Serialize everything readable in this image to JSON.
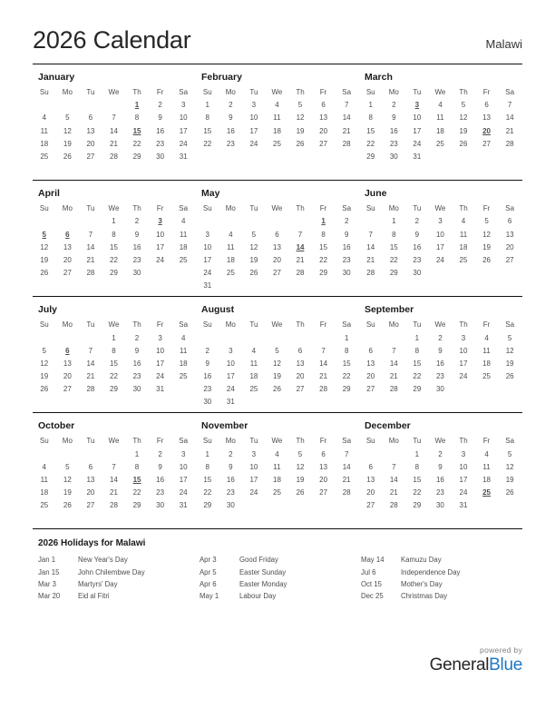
{
  "header": {
    "title": "2026 Calendar",
    "country": "Malawi"
  },
  "weekdays": [
    "Su",
    "Mo",
    "Tu",
    "We",
    "Th",
    "Fr",
    "Sa"
  ],
  "months": [
    {
      "name": "January",
      "weeks": [
        [
          "",
          "",
          "",
          "",
          "1",
          "2",
          "3"
        ],
        [
          "4",
          "5",
          "6",
          "7",
          "8",
          "9",
          "10"
        ],
        [
          "11",
          "12",
          "13",
          "14",
          "15",
          "16",
          "17"
        ],
        [
          "18",
          "19",
          "20",
          "21",
          "22",
          "23",
          "24"
        ],
        [
          "25",
          "26",
          "27",
          "28",
          "29",
          "30",
          "31"
        ],
        [
          "",
          "",
          "",
          "",
          "",
          "",
          ""
        ]
      ],
      "holidays": [
        1,
        15
      ]
    },
    {
      "name": "February",
      "weeks": [
        [
          "1",
          "2",
          "3",
          "4",
          "5",
          "6",
          "7"
        ],
        [
          "8",
          "9",
          "10",
          "11",
          "12",
          "13",
          "14"
        ],
        [
          "15",
          "16",
          "17",
          "18",
          "19",
          "20",
          "21"
        ],
        [
          "22",
          "23",
          "24",
          "25",
          "26",
          "27",
          "28"
        ],
        [
          "",
          "",
          "",
          "",
          "",
          "",
          ""
        ],
        [
          "",
          "",
          "",
          "",
          "",
          "",
          ""
        ]
      ],
      "holidays": []
    },
    {
      "name": "March",
      "weeks": [
        [
          "1",
          "2",
          "3",
          "4",
          "5",
          "6",
          "7"
        ],
        [
          "8",
          "9",
          "10",
          "11",
          "12",
          "13",
          "14"
        ],
        [
          "15",
          "16",
          "17",
          "18",
          "19",
          "20",
          "21"
        ],
        [
          "22",
          "23",
          "24",
          "25",
          "26",
          "27",
          "28"
        ],
        [
          "29",
          "30",
          "31",
          "",
          "",
          "",
          ""
        ],
        [
          "",
          "",
          "",
          "",
          "",
          "",
          ""
        ]
      ],
      "holidays": [
        3,
        20
      ]
    },
    {
      "name": "April",
      "weeks": [
        [
          "",
          "",
          "",
          "1",
          "2",
          "3",
          "4"
        ],
        [
          "5",
          "6",
          "7",
          "8",
          "9",
          "10",
          "11"
        ],
        [
          "12",
          "13",
          "14",
          "15",
          "16",
          "17",
          "18"
        ],
        [
          "19",
          "20",
          "21",
          "22",
          "23",
          "24",
          "25"
        ],
        [
          "26",
          "27",
          "28",
          "29",
          "30",
          "",
          ""
        ],
        [
          "",
          "",
          "",
          "",
          "",
          "",
          ""
        ]
      ],
      "holidays": [
        3,
        5,
        6
      ]
    },
    {
      "name": "May",
      "weeks": [
        [
          "",
          "",
          "",
          "",
          "",
          "1",
          "2"
        ],
        [
          "3",
          "4",
          "5",
          "6",
          "7",
          "8",
          "9"
        ],
        [
          "10",
          "11",
          "12",
          "13",
          "14",
          "15",
          "16"
        ],
        [
          "17",
          "18",
          "19",
          "20",
          "21",
          "22",
          "23"
        ],
        [
          "24",
          "25",
          "26",
          "27",
          "28",
          "29",
          "30"
        ],
        [
          "31",
          "",
          "",
          "",
          "",
          "",
          ""
        ]
      ],
      "holidays": [
        1,
        14
      ]
    },
    {
      "name": "June",
      "weeks": [
        [
          "",
          "1",
          "2",
          "3",
          "4",
          "5",
          "6"
        ],
        [
          "7",
          "8",
          "9",
          "10",
          "11",
          "12",
          "13"
        ],
        [
          "14",
          "15",
          "16",
          "17",
          "18",
          "19",
          "20"
        ],
        [
          "21",
          "22",
          "23",
          "24",
          "25",
          "26",
          "27"
        ],
        [
          "28",
          "29",
          "30",
          "",
          "",
          "",
          ""
        ],
        [
          "",
          "",
          "",
          "",
          "",
          "",
          ""
        ]
      ],
      "holidays": []
    },
    {
      "name": "July",
      "weeks": [
        [
          "",
          "",
          "",
          "1",
          "2",
          "3",
          "4"
        ],
        [
          "5",
          "6",
          "7",
          "8",
          "9",
          "10",
          "11"
        ],
        [
          "12",
          "13",
          "14",
          "15",
          "16",
          "17",
          "18"
        ],
        [
          "19",
          "20",
          "21",
          "22",
          "23",
          "24",
          "25"
        ],
        [
          "26",
          "27",
          "28",
          "29",
          "30",
          "31",
          ""
        ],
        [
          "",
          "",
          "",
          "",
          "",
          "",
          ""
        ]
      ],
      "holidays": [
        6
      ]
    },
    {
      "name": "August",
      "weeks": [
        [
          "",
          "",
          "",
          "",
          "",
          "",
          "1"
        ],
        [
          "2",
          "3",
          "4",
          "5",
          "6",
          "7",
          "8"
        ],
        [
          "9",
          "10",
          "11",
          "12",
          "13",
          "14",
          "15"
        ],
        [
          "16",
          "17",
          "18",
          "19",
          "20",
          "21",
          "22"
        ],
        [
          "23",
          "24",
          "25",
          "26",
          "27",
          "28",
          "29"
        ],
        [
          "30",
          "31",
          "",
          "",
          "",
          "",
          ""
        ]
      ],
      "holidays": []
    },
    {
      "name": "September",
      "weeks": [
        [
          "",
          "",
          "1",
          "2",
          "3",
          "4",
          "5"
        ],
        [
          "6",
          "7",
          "8",
          "9",
          "10",
          "11",
          "12"
        ],
        [
          "13",
          "14",
          "15",
          "16",
          "17",
          "18",
          "19"
        ],
        [
          "20",
          "21",
          "22",
          "23",
          "24",
          "25",
          "26"
        ],
        [
          "27",
          "28",
          "29",
          "30",
          "",
          "",
          ""
        ],
        [
          "",
          "",
          "",
          "",
          "",
          "",
          ""
        ]
      ],
      "holidays": []
    },
    {
      "name": "October",
      "weeks": [
        [
          "",
          "",
          "",
          "",
          "1",
          "2",
          "3"
        ],
        [
          "4",
          "5",
          "6",
          "7",
          "8",
          "9",
          "10"
        ],
        [
          "11",
          "12",
          "13",
          "14",
          "15",
          "16",
          "17"
        ],
        [
          "18",
          "19",
          "20",
          "21",
          "22",
          "23",
          "24"
        ],
        [
          "25",
          "26",
          "27",
          "28",
          "29",
          "30",
          "31"
        ],
        [
          "",
          "",
          "",
          "",
          "",
          "",
          ""
        ]
      ],
      "holidays": [
        15
      ]
    },
    {
      "name": "November",
      "weeks": [
        [
          "1",
          "2",
          "3",
          "4",
          "5",
          "6",
          "7"
        ],
        [
          "8",
          "9",
          "10",
          "11",
          "12",
          "13",
          "14"
        ],
        [
          "15",
          "16",
          "17",
          "18",
          "19",
          "20",
          "21"
        ],
        [
          "22",
          "23",
          "24",
          "25",
          "26",
          "27",
          "28"
        ],
        [
          "29",
          "30",
          "",
          "",
          "",
          "",
          ""
        ],
        [
          "",
          "",
          "",
          "",
          "",
          "",
          ""
        ]
      ],
      "holidays": []
    },
    {
      "name": "December",
      "weeks": [
        [
          "",
          "",
          "1",
          "2",
          "3",
          "4",
          "5"
        ],
        [
          "6",
          "7",
          "8",
          "9",
          "10",
          "11",
          "12"
        ],
        [
          "13",
          "14",
          "15",
          "16",
          "17",
          "18",
          "19"
        ],
        [
          "20",
          "21",
          "22",
          "23",
          "24",
          "25",
          "26"
        ],
        [
          "27",
          "28",
          "29",
          "30",
          "31",
          "",
          ""
        ],
        [
          "",
          "",
          "",
          "",
          "",
          "",
          ""
        ]
      ],
      "holidays": [
        25
      ]
    }
  ],
  "holidays_section": {
    "title": "2026 Holidays for Malawi",
    "columns": [
      [
        {
          "date": "Jan 1",
          "name": "New Year's Day"
        },
        {
          "date": "Jan 15",
          "name": "John Chilembwe Day"
        },
        {
          "date": "Mar 3",
          "name": "Martyrs' Day"
        },
        {
          "date": "Mar 20",
          "name": "Eid al Fitri"
        }
      ],
      [
        {
          "date": "Apr 3",
          "name": "Good Friday"
        },
        {
          "date": "Apr 5",
          "name": "Easter Sunday"
        },
        {
          "date": "Apr 6",
          "name": "Easter Monday"
        },
        {
          "date": "May 1",
          "name": "Labour Day"
        }
      ],
      [
        {
          "date": "May 14",
          "name": "Kamuzu Day"
        },
        {
          "date": "Jul 6",
          "name": "Independence Day"
        },
        {
          "date": "Oct 15",
          "name": "Mother's Day"
        },
        {
          "date": "Dec 25",
          "name": "Christmas Day"
        }
      ]
    ]
  },
  "footer": {
    "powered_by": "powered by",
    "brand_first": "General",
    "brand_second": "Blue"
  },
  "colors": {
    "holiday": "#e00000",
    "brand_blue": "#1f77c4",
    "text": "#4d4d4d"
  }
}
